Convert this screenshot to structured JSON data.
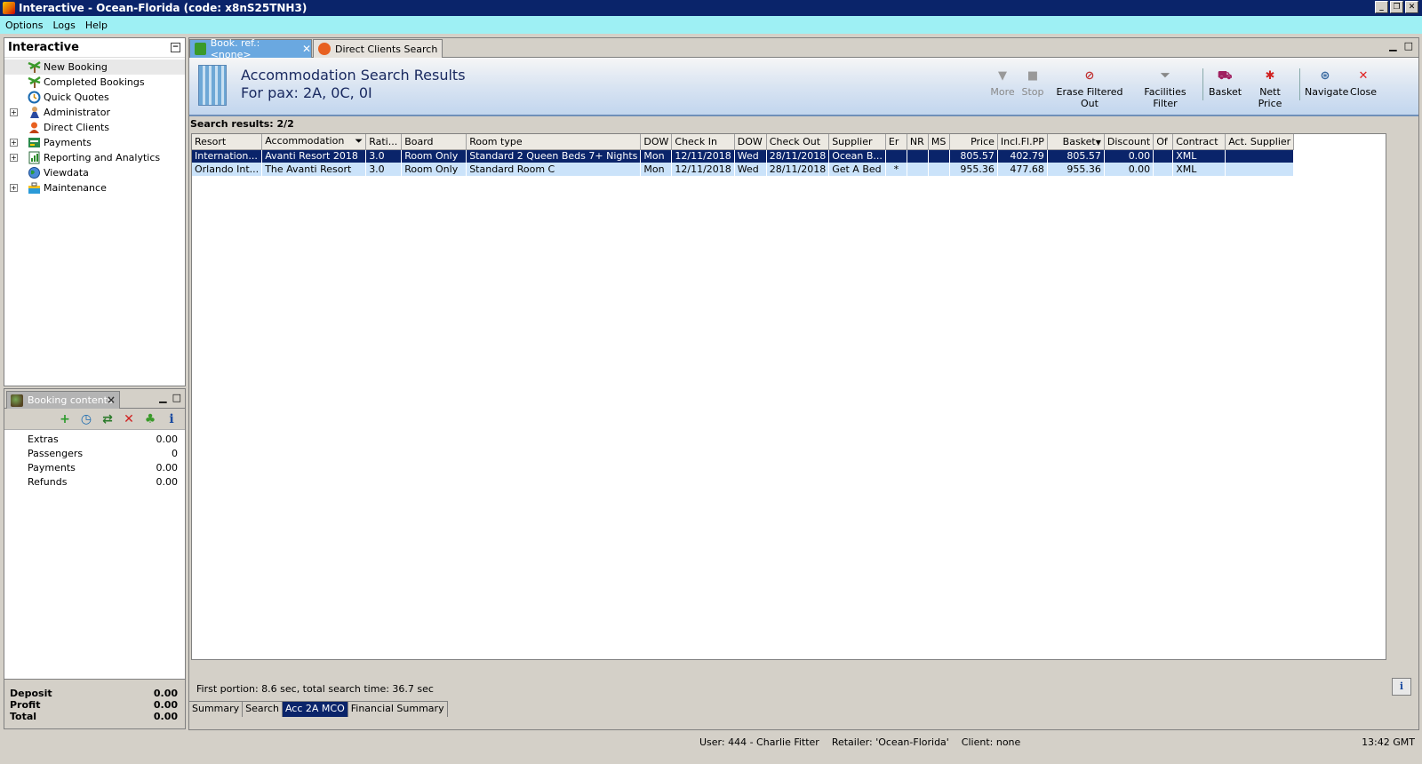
{
  "window": {
    "title": "Interactive - Ocean-Florida (code: x8nS25TNH3)",
    "buttons": [
      "_",
      "❐",
      "✕"
    ]
  },
  "menu": {
    "items": [
      "Options",
      "Logs",
      "Help"
    ]
  },
  "left_panel": {
    "title": "Interactive",
    "items": [
      {
        "label": "New Booking",
        "icon": "palm-tree-icon",
        "expandable": false,
        "selected": true
      },
      {
        "label": "Completed Bookings",
        "icon": "palm-tree-icon",
        "expandable": false
      },
      {
        "label": "Quick Quotes",
        "icon": "clock-icon",
        "expandable": false
      },
      {
        "label": "Administrator",
        "icon": "person-icon",
        "expandable": true
      },
      {
        "label": "Direct Clients",
        "icon": "clients-icon",
        "expandable": false
      },
      {
        "label": "Payments",
        "icon": "payments-icon",
        "expandable": true
      },
      {
        "label": "Reporting and Analytics",
        "icon": "report-icon",
        "expandable": true
      },
      {
        "label": "Viewdata",
        "icon": "globe-icon",
        "expandable": false
      },
      {
        "label": "Maintenance",
        "icon": "toolbox-icon",
        "expandable": true
      }
    ]
  },
  "booking_contents": {
    "tab_label": "Booking contents",
    "rows": [
      {
        "label": "Extras",
        "value": "0.00"
      },
      {
        "label": "Passengers",
        "value": "0"
      },
      {
        "label": "Payments",
        "value": "0.00"
      },
      {
        "label": "Refunds",
        "value": "0.00"
      }
    ],
    "footer": [
      {
        "label": "Deposit",
        "value": "0.00"
      },
      {
        "label": "Profit",
        "value": "0.00"
      },
      {
        "label": "Total",
        "value": "0.00"
      }
    ]
  },
  "tabs": [
    {
      "label": "Book. ref.: <none>",
      "active": true
    },
    {
      "label": "Direct Clients Search",
      "active": false
    }
  ],
  "header": {
    "title": "Accommodation Search Results",
    "subtitle": "For pax: 2A, 0C, 0I"
  },
  "toolbar": [
    {
      "label": "More",
      "icon": "more-icon",
      "enabled": false
    },
    {
      "label": "Stop",
      "icon": "stop-icon",
      "enabled": false
    },
    {
      "label": "Erase Filtered Out",
      "icon": "erase-filter-icon",
      "enabled": true
    },
    {
      "label": "Facilities Filter",
      "icon": "funnel-icon",
      "enabled": true
    },
    {
      "label": "Basket",
      "icon": "basket-icon",
      "enabled": true
    },
    {
      "label": "Nett Price",
      "icon": "nett-price-icon",
      "enabled": true
    },
    {
      "label": "Navigate",
      "icon": "navigate-icon",
      "enabled": true
    },
    {
      "label": "Close",
      "icon": "close-icon",
      "enabled": true
    }
  ],
  "results": {
    "summary": "Search results: 2/2",
    "columns": [
      "Resort",
      "Accommodation",
      "Rati...",
      "Board",
      "Room type",
      "DOW",
      "Check In",
      "DOW",
      "Check Out",
      "Supplier",
      "Er",
      "NR",
      "MS",
      "Price",
      "Incl.Fl.PP",
      "Basket",
      "Discount",
      "Of",
      "Contract",
      "Act. Supplier"
    ],
    "rows": [
      [
        "Internation...",
        "Avanti Resort 2018",
        "3.0",
        "Room Only",
        "Standard 2 Queen Beds 7+  Nights",
        "Mon",
        "12/11/2018",
        "Wed",
        "28/11/2018",
        "Ocean B...",
        "",
        "",
        "",
        "805.57",
        "402.79",
        "805.57",
        "0.00",
        "",
        "XML",
        ""
      ],
      [
        "Orlando Int...",
        "The Avanti Resort",
        "3.0",
        "Room Only",
        "Standard Room C",
        "Mon",
        "12/11/2018",
        "Wed",
        "28/11/2018",
        "Get A Bed",
        "*",
        "",
        "",
        "955.36",
        "477.68",
        "955.36",
        "0.00",
        "",
        "XML",
        ""
      ]
    ]
  },
  "status_line": "First portion: 8.6 sec, total search time: 36.7 sec",
  "bottom_tabs": [
    {
      "label": "Summary",
      "active": false
    },
    {
      "label": "Search",
      "active": false
    },
    {
      "label": "Acc 2A MCO",
      "active": true
    },
    {
      "label": "Financial Summary",
      "active": false
    }
  ],
  "statusbar": {
    "user_info": "User: 444 - Charlie Fitter    Retailer: 'Ocean-Florida'    Client: none",
    "time": "13:42 GMT"
  }
}
